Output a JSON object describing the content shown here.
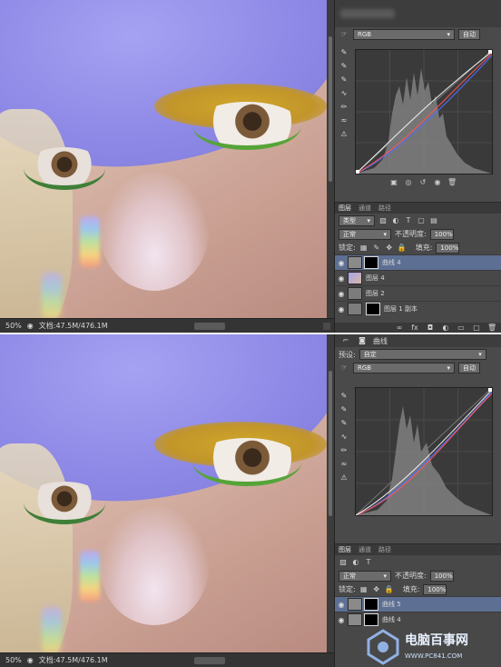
{
  "top": {
    "props": {
      "channel": "RGB",
      "auto_label": "自动",
      "tools": [
        "curves-adjust",
        "eyedropper-black",
        "eyedropper-gray",
        "eyedropper-white",
        "curve-point",
        "pencil",
        "smooth",
        "warning"
      ]
    },
    "layers": {
      "tabs": [
        "图层",
        "通道",
        "路径"
      ],
      "filter_kind": "类型",
      "blend_mode": "正常",
      "opacity_label": "不透明度:",
      "opacity_value": "100%",
      "lock_label": "锁定:",
      "fill_label": "填充:",
      "fill_value": "100%",
      "rows": [
        {
          "name": "曲线 4",
          "selected": true
        },
        {
          "name": "图层 4"
        },
        {
          "name": "图层 2"
        },
        {
          "name": "图层 1 副本"
        }
      ]
    },
    "status": {
      "zoom": "50%",
      "doc": "文档:47.5M/476.1M"
    }
  },
  "bottom": {
    "props": {
      "title": "曲线",
      "preset_label": "预设:",
      "preset_value": "自定",
      "channel": "RGB",
      "auto_label": "自动"
    },
    "layers": {
      "tabs": [
        "图层",
        "通道",
        "路径"
      ],
      "blend_mode": "正常",
      "opacity_label": "不透明度:",
      "opacity_value": "100%",
      "lock_label": "锁定:",
      "fill_label": "填充:",
      "fill_value": "100%",
      "rows": [
        {
          "name": "曲线 5",
          "selected": true
        },
        {
          "name": "曲线 4"
        }
      ]
    },
    "status": {
      "zoom": "50%",
      "doc": "文档:47.5M/476.1M"
    }
  },
  "watermark": {
    "name": "电脑百事网",
    "url": "WWW.PC841.COM"
  },
  "colors": {
    "panel": "#4a4a4a",
    "selected": "#5d6f93",
    "skin_purple": "#8e89e6"
  }
}
